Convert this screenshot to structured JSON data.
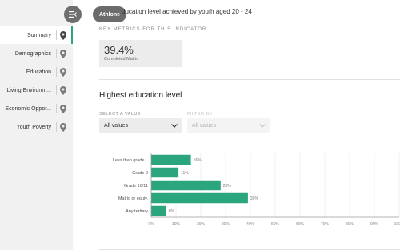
{
  "header": {
    "tooltip": "Athlone",
    "title": "ducation level achieved by youth aged 20 - 24"
  },
  "sidebar": {
    "items": [
      {
        "label": "Summary",
        "active": true
      },
      {
        "label": "Demographics",
        "active": false
      },
      {
        "label": "Education",
        "active": false
      },
      {
        "label": "Living Environm...",
        "active": false
      },
      {
        "label": "Economic Oppor...",
        "active": false
      },
      {
        "label": "Youth Poverty",
        "active": false
      }
    ]
  },
  "key_metrics": {
    "caption": "KEY METRICS FOR THIS INDICATOR",
    "value": "39.4%",
    "label": "Completed Matric"
  },
  "section": {
    "title": "Highest education level",
    "select_caption": "SELECT A VALUE",
    "select_value": "All values",
    "filter_caption": "FILTER BY",
    "filter_value": "All values"
  },
  "colors": {
    "accent": "#2aa57e",
    "bar": "#2aa57e"
  },
  "chart_data": {
    "type": "bar",
    "orientation": "horizontal",
    "categories": [
      "Less than grade...",
      "Grade 9",
      "Grade 10/11",
      "Matric or equiv.",
      "Any tertiary"
    ],
    "values": [
      16,
      11,
      28,
      39,
      6
    ],
    "value_labels": [
      "16%",
      "11%",
      "28%",
      "39%",
      "6%"
    ],
    "xlim": [
      0,
      100
    ],
    "x_ticks": [
      "0%",
      "10%",
      "20%",
      "30%",
      "40%",
      "50%",
      "60%",
      "70%",
      "80%",
      "90%",
      "100%"
    ],
    "grid": true
  }
}
